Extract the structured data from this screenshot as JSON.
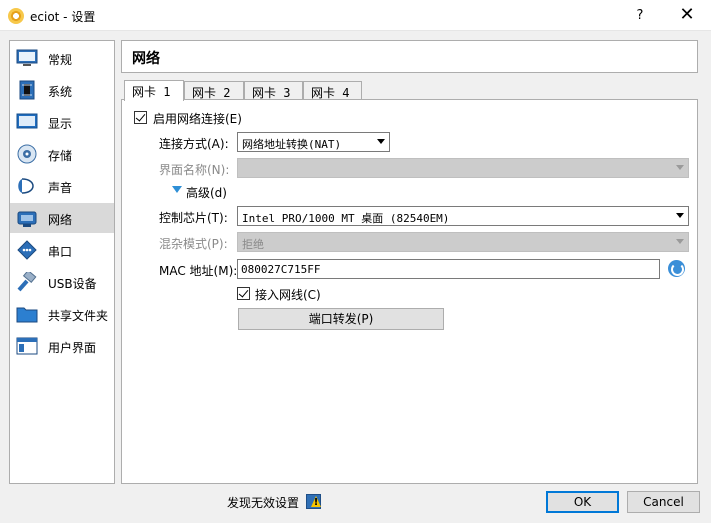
{
  "window": {
    "title": "eciot - 设置",
    "help_label": "?",
    "close_label": "✕"
  },
  "sidebar": {
    "items": [
      {
        "label": "常规",
        "icon": "general-icon"
      },
      {
        "label": "系统",
        "icon": "system-icon"
      },
      {
        "label": "显示",
        "icon": "display-icon"
      },
      {
        "label": "存储",
        "icon": "storage-icon"
      },
      {
        "label": "声音",
        "icon": "audio-icon"
      },
      {
        "label": "网络",
        "icon": "network-icon",
        "active": true
      },
      {
        "label": "串口",
        "icon": "serial-port-icon"
      },
      {
        "label": "USB设备",
        "icon": "usb-icon"
      },
      {
        "label": "共享文件夹",
        "icon": "shared-folder-icon"
      },
      {
        "label": "用户界面",
        "icon": "user-interface-icon"
      }
    ]
  },
  "section": {
    "title": "网络"
  },
  "tabs": [
    {
      "label": "网卡 1",
      "active": true
    },
    {
      "label": "网卡 2"
    },
    {
      "label": "网卡 3"
    },
    {
      "label": "网卡 4"
    }
  ],
  "adapter": {
    "enable_label": "启用网络连接(E)",
    "enable_checked": true,
    "attached_label": "连接方式(A):",
    "attached_value": "网络地址转换(NAT)",
    "name_label": "界面名称(N):",
    "name_value": "",
    "advanced_label": "高级(d)",
    "adapter_type_label": "控制芯片(T):",
    "adapter_type_value": "Intel PRO/1000 MT 桌面 (82540EM)",
    "promisc_label": "混杂模式(P):",
    "promisc_value": "拒绝",
    "mac_label": "MAC 地址(M):",
    "mac_value": "080027C715FF",
    "cable_label": "接入网线(C)",
    "cable_checked": true,
    "port_forward_label": "端口转发(P)"
  },
  "footer": {
    "invalid_settings_label": "发现无效设置",
    "ok_label": "OK",
    "cancel_label": "Cancel"
  },
  "colors": {
    "accent": "#0078d7",
    "selected_item_bg": "#d9d9d9",
    "link_blue": "#2e8fd6"
  }
}
